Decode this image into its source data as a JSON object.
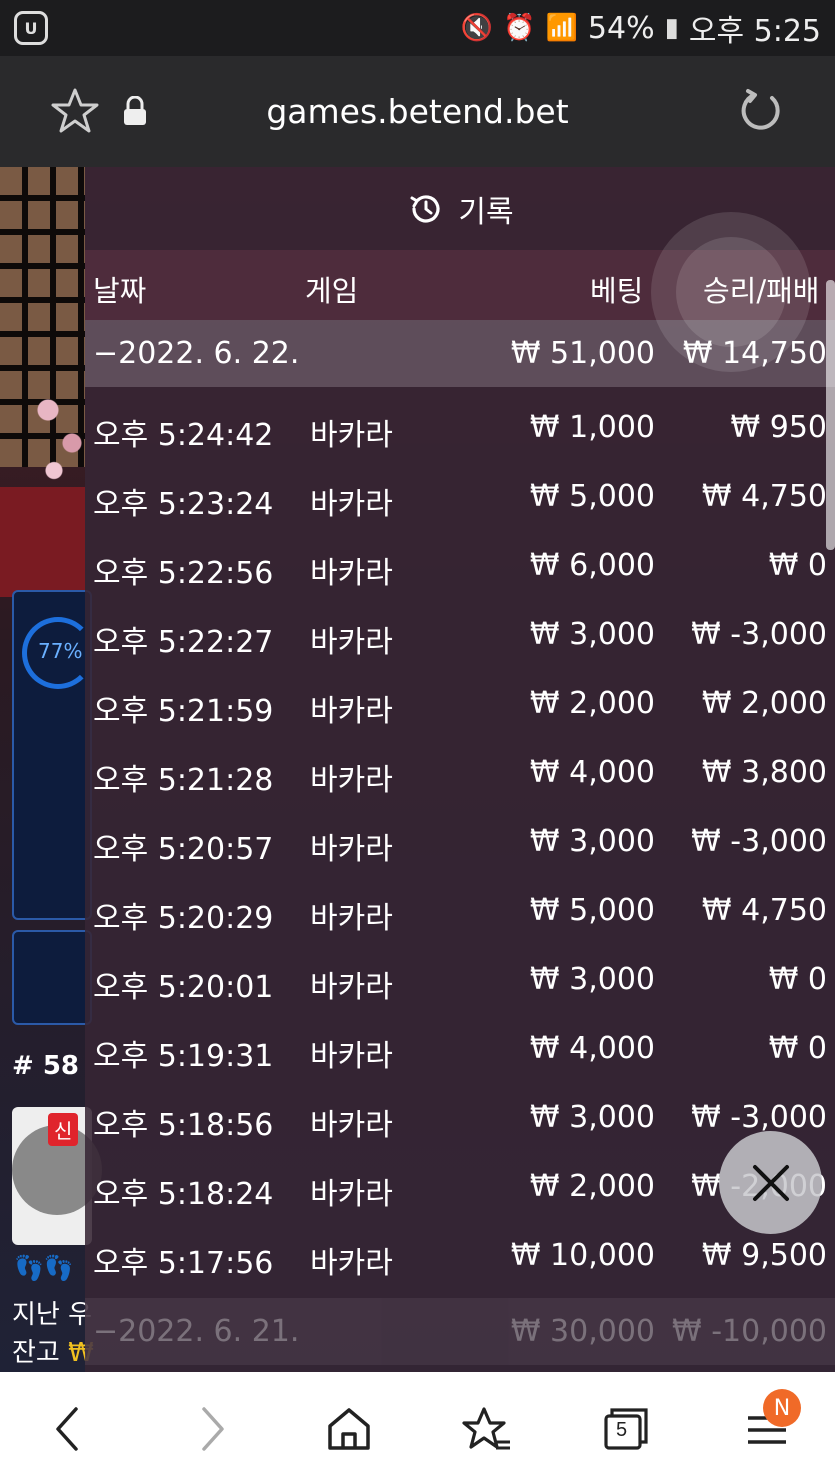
{
  "status_bar": {
    "battery": "54%",
    "time": "오후 5:25"
  },
  "url_bar": {
    "url": "games.betend.bet"
  },
  "game_background": {
    "progress_percent": "77%",
    "round_label": "# 58",
    "thumb_badge": "신",
    "bottom_line1": "지난 우",
    "bottom_line2_label": "잔고",
    "bottom_line2_value": "₩"
  },
  "history": {
    "title": "기록",
    "columns": {
      "date": "날짜",
      "game": "게임",
      "bet": "베팅",
      "result": "승리/패배"
    },
    "day_summary": {
      "date": "−2022. 6. 22.",
      "bet": "₩ 51,000",
      "result": "₩ 14,750"
    },
    "rows": [
      {
        "time": "오후 5:24:42",
        "game": "바카라",
        "bet": "₩ 1,000",
        "result": "₩ 950"
      },
      {
        "time": "오후 5:23:24",
        "game": "바카라",
        "bet": "₩ 5,000",
        "result": "₩ 4,750"
      },
      {
        "time": "오후 5:22:56",
        "game": "바카라",
        "bet": "₩ 6,000",
        "result": "₩ 0"
      },
      {
        "time": "오후 5:22:27",
        "game": "바카라",
        "bet": "₩ 3,000",
        "result": "₩ -3,000"
      },
      {
        "time": "오후 5:21:59",
        "game": "바카라",
        "bet": "₩ 2,000",
        "result": "₩ 2,000"
      },
      {
        "time": "오후 5:21:28",
        "game": "바카라",
        "bet": "₩ 4,000",
        "result": "₩ 3,800"
      },
      {
        "time": "오후 5:20:57",
        "game": "바카라",
        "bet": "₩ 3,000",
        "result": "₩ -3,000"
      },
      {
        "time": "오후 5:20:29",
        "game": "바카라",
        "bet": "₩ 5,000",
        "result": "₩ 4,750"
      },
      {
        "time": "오후 5:20:01",
        "game": "바카라",
        "bet": "₩ 3,000",
        "result": "₩ 0"
      },
      {
        "time": "오후 5:19:31",
        "game": "바카라",
        "bet": "₩ 4,000",
        "result": "₩ 0"
      },
      {
        "time": "오후 5:18:56",
        "game": "바카라",
        "bet": "₩ 3,000",
        "result": "₩ -3,000"
      },
      {
        "time": "오후 5:18:24",
        "game": "바카라",
        "bet": "₩ 2,000",
        "result": "₩ -2,000"
      },
      {
        "time": "오후 5:17:56",
        "game": "바카라",
        "bet": "₩ 10,000",
        "result": "₩ 9,500"
      }
    ],
    "next_day_summary": {
      "date": "−2022. 6. 21.",
      "bet": "₩ 30,000",
      "result": "₩ -10,000"
    }
  },
  "bottom_nav": {
    "tabs_count": "5",
    "menu_badge": "N"
  }
}
